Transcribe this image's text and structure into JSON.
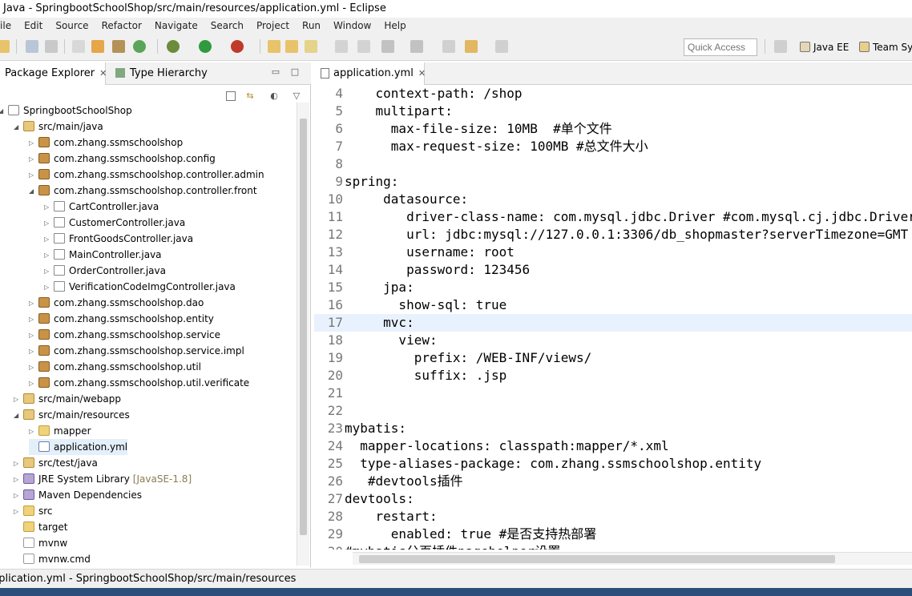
{
  "window": {
    "title": "Java - SpringbootSchoolShop/src/main/resources/application.yml - Eclipse"
  },
  "menu": [
    "File",
    "Edit",
    "Source",
    "Refactor",
    "Navigate",
    "Search",
    "Project",
    "Run",
    "Window",
    "Help"
  ],
  "toolbar": {
    "quick_access_placeholder": "Quick Access",
    "perspectives": [
      "Java EE",
      "Team Sy"
    ]
  },
  "left_panel": {
    "tabs": [
      {
        "label": "Package Explorer",
        "active": true
      },
      {
        "label": "Type Hierarchy",
        "active": false
      }
    ],
    "tree": [
      {
        "label": "SpringbootSchoolShop",
        "icon": "project-icon",
        "depth": 0,
        "state": "expanded"
      },
      {
        "label": "src/main/java",
        "icon": "source-folder-icon",
        "depth": 1,
        "state": "expanded"
      },
      {
        "label": "com.zhang.ssmschoolshop",
        "icon": "package-icon",
        "depth": 2,
        "state": "collapsed"
      },
      {
        "label": "com.zhang.ssmschoolshop.config",
        "icon": "package-icon",
        "depth": 2,
        "state": "collapsed"
      },
      {
        "label": "com.zhang.ssmschoolshop.controller.admin",
        "icon": "package-icon",
        "depth": 2,
        "state": "collapsed"
      },
      {
        "label": "com.zhang.ssmschoolshop.controller.front",
        "icon": "package-icon",
        "depth": 2,
        "state": "expanded"
      },
      {
        "label": "CartController.java",
        "icon": "java-file-icon",
        "depth": 3,
        "state": "collapsed"
      },
      {
        "label": "CustomerController.java",
        "icon": "java-file-icon",
        "depth": 3,
        "state": "collapsed"
      },
      {
        "label": "FrontGoodsController.java",
        "icon": "java-file-icon",
        "depth": 3,
        "state": "collapsed"
      },
      {
        "label": "MainController.java",
        "icon": "java-file-icon",
        "depth": 3,
        "state": "collapsed"
      },
      {
        "label": "OrderController.java",
        "icon": "java-file-icon",
        "depth": 3,
        "state": "collapsed"
      },
      {
        "label": "VerificationCodeImgController.java",
        "icon": "java-file-icon",
        "depth": 3,
        "state": "collapsed"
      },
      {
        "label": "com.zhang.ssmschoolshop.dao",
        "icon": "package-icon",
        "depth": 2,
        "state": "collapsed"
      },
      {
        "label": "com.zhang.ssmschoolshop.entity",
        "icon": "package-icon",
        "depth": 2,
        "state": "collapsed"
      },
      {
        "label": "com.zhang.ssmschoolshop.service",
        "icon": "package-icon",
        "depth": 2,
        "state": "collapsed"
      },
      {
        "label": "com.zhang.ssmschoolshop.service.impl",
        "icon": "package-icon",
        "depth": 2,
        "state": "collapsed"
      },
      {
        "label": "com.zhang.ssmschoolshop.util",
        "icon": "package-icon",
        "depth": 2,
        "state": "collapsed"
      },
      {
        "label": "com.zhang.ssmschoolshop.util.verificate",
        "icon": "package-icon",
        "depth": 2,
        "state": "collapsed"
      },
      {
        "label": "src/main/webapp",
        "icon": "source-folder-icon",
        "depth": 1,
        "state": "collapsed"
      },
      {
        "label": "src/main/resources",
        "icon": "source-folder-icon",
        "depth": 1,
        "state": "expanded"
      },
      {
        "label": "mapper",
        "icon": "folder-icon",
        "depth": 2,
        "state": "collapsed"
      },
      {
        "label": "application.yml",
        "icon": "yml-file-icon",
        "depth": 2,
        "state": "none",
        "selected": true
      },
      {
        "label": "src/test/java",
        "icon": "source-folder-icon",
        "depth": 1,
        "state": "collapsed"
      },
      {
        "label": "JRE System Library",
        "suffix": "[JavaSE-1.8]",
        "icon": "library-icon",
        "depth": 1,
        "state": "collapsed"
      },
      {
        "label": "Maven Dependencies",
        "icon": "library-icon",
        "depth": 1,
        "state": "collapsed"
      },
      {
        "label": "src",
        "icon": "folder-icon",
        "depth": 1,
        "state": "collapsed"
      },
      {
        "label": "target",
        "icon": "folder-icon",
        "depth": 1,
        "state": "none"
      },
      {
        "label": "mvnw",
        "icon": "file-icon",
        "depth": 1,
        "state": "none"
      },
      {
        "label": "mvnw.cmd",
        "icon": "file-icon",
        "depth": 1,
        "state": "none"
      }
    ]
  },
  "editor": {
    "tab_label": "application.yml",
    "current_line": 17,
    "lines": [
      {
        "n": "4",
        "text": "    context-path: /shop"
      },
      {
        "n": "5",
        "text": "    multipart:"
      },
      {
        "n": "6",
        "text": "      max-file-size: 10MB  #单个文件"
      },
      {
        "n": "7",
        "text": "      max-request-size: 100MB #总文件大小"
      },
      {
        "n": "8",
        "text": ""
      },
      {
        "n": "9",
        "text": "spring:"
      },
      {
        "n": "10",
        "text": "     datasource:"
      },
      {
        "n": "11",
        "text": "        driver-class-name: com.mysql.jdbc.Driver #com.mysql.cj.jdbc.Driver"
      },
      {
        "n": "12",
        "text": "        url: jdbc:mysql://127.0.0.1:3306/db_shopmaster?serverTimezone=GMT"
      },
      {
        "n": "13",
        "text": "        username: root"
      },
      {
        "n": "14",
        "text": "        password: 123456"
      },
      {
        "n": "15",
        "text": "     jpa:"
      },
      {
        "n": "16",
        "text": "       show-sql: true"
      },
      {
        "n": "17",
        "text": "     mvc:"
      },
      {
        "n": "18",
        "text": "       view:"
      },
      {
        "n": "19",
        "text": "         prefix: /WEB-INF/views/"
      },
      {
        "n": "20",
        "text": "         suffix: .jsp"
      },
      {
        "n": "21",
        "text": ""
      },
      {
        "n": "22",
        "text": ""
      },
      {
        "n": "23",
        "text": "mybatis:"
      },
      {
        "n": "24",
        "text": "  mapper-locations: classpath:mapper/*.xml"
      },
      {
        "n": "25",
        "text": "  type-aliases-package: com.zhang.ssmschoolshop.entity"
      },
      {
        "n": "26",
        "text": "   #devtools插件"
      },
      {
        "n": "27",
        "text": "devtools:"
      },
      {
        "n": "28",
        "text": "    restart:"
      },
      {
        "n": "29",
        "text": "      enabled: true #是否支持热部署"
      },
      {
        "n": "30",
        "text": "#mybatis分页插件pagehelper设置"
      }
    ]
  },
  "status_bar": {
    "text": "application.yml - SpringbootSchoolShop/src/main/resources"
  }
}
